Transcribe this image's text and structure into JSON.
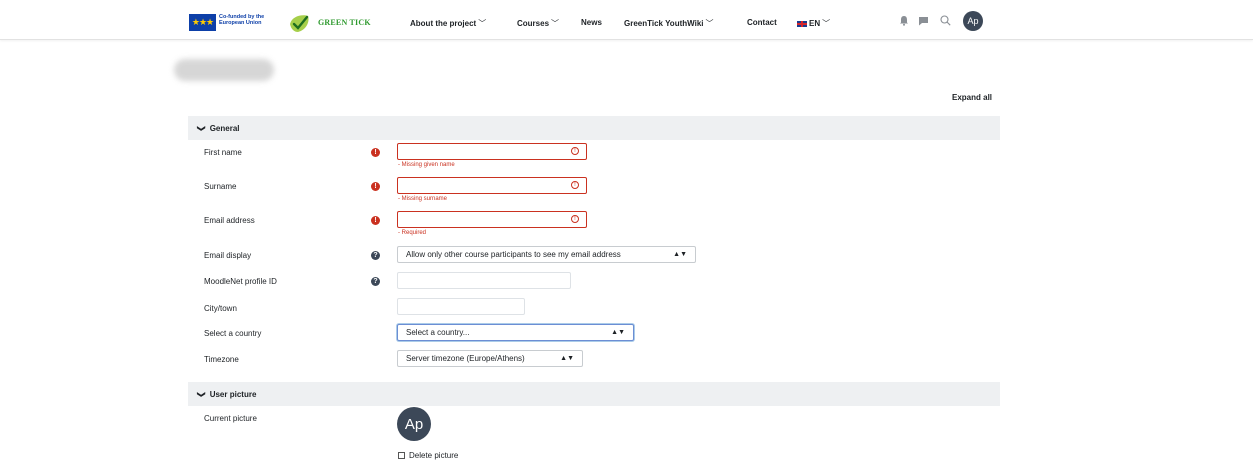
{
  "header": {
    "eu_text": "Co-funded by the European Union",
    "brand": "GREEN TICK",
    "nav": [
      {
        "label": "About the project",
        "dropdown": true
      },
      {
        "label": "Courses",
        "dropdown": true
      },
      {
        "label": "News",
        "dropdown": false
      },
      {
        "label": "GreenTick YouthWiki",
        "dropdown": true
      },
      {
        "label": "Contact",
        "dropdown": false
      },
      {
        "label": "EN",
        "dropdown": true
      }
    ],
    "icons": [
      "bell-icon",
      "chat-icon",
      "search-icon"
    ],
    "avatar_initials": "Ap"
  },
  "page": {
    "expand_all": "Expand all"
  },
  "sections": {
    "general": "General",
    "user_picture": "User picture"
  },
  "form": {
    "first_name": {
      "label": "First name",
      "value": "",
      "error": "- Missing given name"
    },
    "surname": {
      "label": "Surname",
      "value": "",
      "error": "- Missing surname"
    },
    "email": {
      "label": "Email address",
      "value": "",
      "error": "- Required"
    },
    "email_display": {
      "label": "Email display",
      "value": "Allow only other course participants to see my email address"
    },
    "moodlenet": {
      "label": "MoodleNet profile ID",
      "value": ""
    },
    "city": {
      "label": "City/town",
      "value": ""
    },
    "country": {
      "label": "Select a country",
      "value": "Select a country..."
    },
    "timezone": {
      "label": "Timezone",
      "value": "Server timezone (Europe/Athens)"
    }
  },
  "picture": {
    "current_label": "Current picture",
    "avatar_initials": "Ap",
    "delete_label": "Delete picture"
  },
  "colors": {
    "error": "#ca3120",
    "section_bg": "#eef0f2",
    "avatar_bg": "#3c4858",
    "brand_green": "#2f9a2f",
    "eu_blue": "#0d3fa8"
  }
}
